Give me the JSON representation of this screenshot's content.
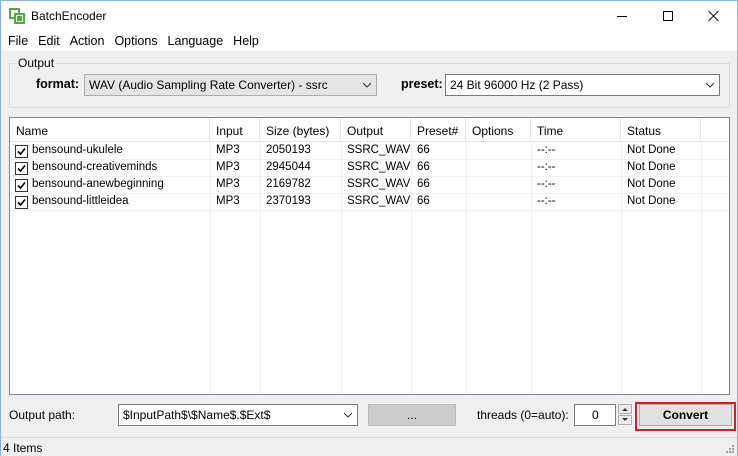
{
  "window": {
    "title": "BatchEncoder"
  },
  "menu": [
    "File",
    "Edit",
    "Action",
    "Options",
    "Language",
    "Help"
  ],
  "output_group": {
    "label": "Output",
    "format_label": "format:",
    "format_value": "WAV (Audio Sampling Rate Converter) - ssrc",
    "preset_label": "preset:",
    "preset_value": "24 Bit 96000 Hz (2 Pass)"
  },
  "table": {
    "columns": [
      "Name",
      "Input",
      "Size (bytes)",
      "Output",
      "Preset#",
      "Options",
      "Time",
      "Status"
    ],
    "rows": [
      {
        "checked": true,
        "name": "bensound-ukulele",
        "input": "MP3",
        "size": "2050193",
        "output": "SSRC_WAV",
        "preset": "66",
        "options": "",
        "time": "--:--",
        "status": "Not Done"
      },
      {
        "checked": true,
        "name": "bensound-creativeminds",
        "input": "MP3",
        "size": "2945044",
        "output": "SSRC_WAV",
        "preset": "66",
        "options": "",
        "time": "--:--",
        "status": "Not Done"
      },
      {
        "checked": true,
        "name": "bensound-anewbeginning",
        "input": "MP3",
        "size": "2169782",
        "output": "SSRC_WAV",
        "preset": "66",
        "options": "",
        "time": "--:--",
        "status": "Not Done"
      },
      {
        "checked": true,
        "name": "bensound-littleidea",
        "input": "MP3",
        "size": "2370193",
        "output": "SSRC_WAV",
        "preset": "66",
        "options": "",
        "time": "--:--",
        "status": "Not Done"
      }
    ]
  },
  "bottom": {
    "output_path_label": "Output path:",
    "output_path_value": "$InputPath$\\$Name$.$Ext$",
    "browse_label": "...",
    "threads_label": "threads (0=auto):",
    "threads_value": "0",
    "convert_label": "Convert"
  },
  "status": {
    "items_text": "4 Items"
  },
  "colors": {
    "highlight": "#e01b1b",
    "app_icon_green": "#4caf3d"
  }
}
